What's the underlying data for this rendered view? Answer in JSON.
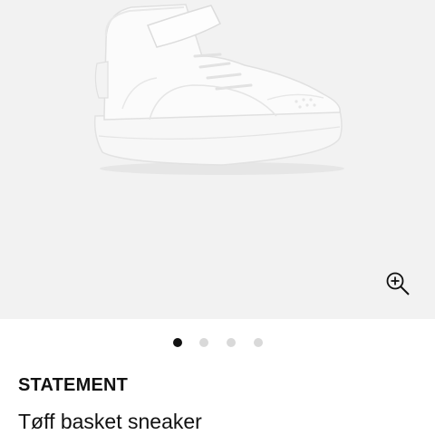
{
  "gallery": {
    "image_alt": "white high-top sneaker",
    "zoom_icon": "zoom-in-icon",
    "dots_total": 4,
    "active_dot": 0
  },
  "product": {
    "brand": "STATEMENT",
    "name": "Tøff basket sneaker"
  },
  "colors": {
    "gallery_bg": "#f2f2f2",
    "dot_active": "#111111",
    "dot_inactive": "#d9d9d9",
    "text": "#111111"
  }
}
